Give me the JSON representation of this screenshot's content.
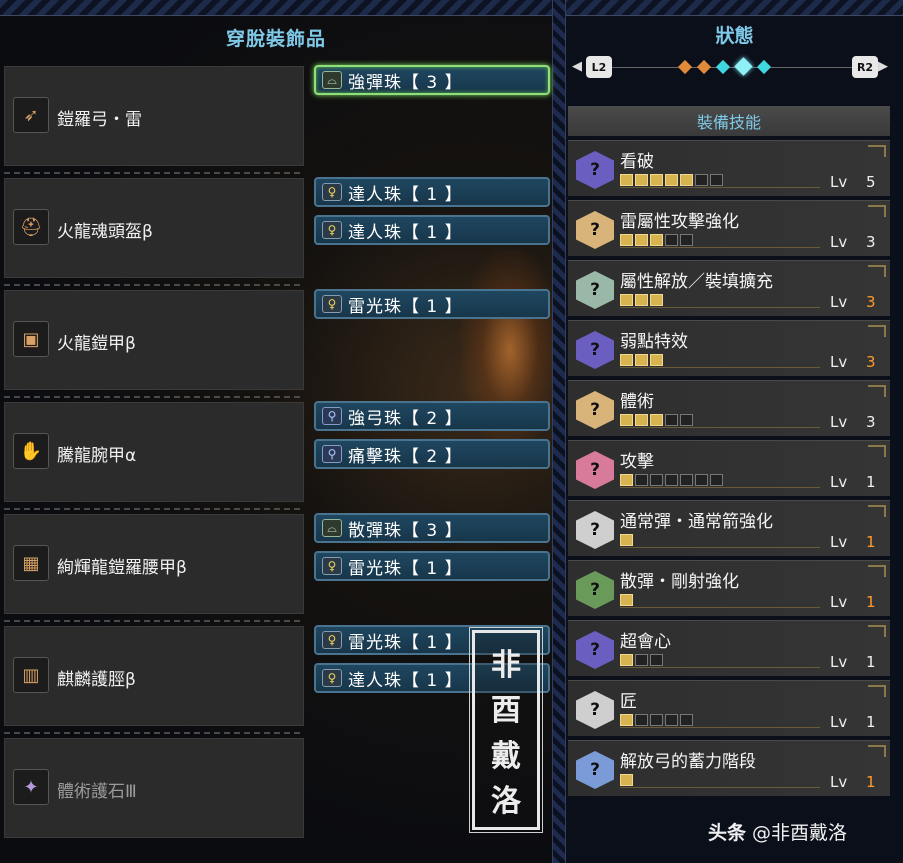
{
  "left_header": "穿脫裝飾品",
  "right_header": "狀態",
  "nav": {
    "left_button": "L2",
    "right_button": "R2"
  },
  "equipment": [
    {
      "name": "鎧羅弓・雷",
      "icon": "bow-icon",
      "slots": [
        {
          "label": "強彈珠【 3 】",
          "level": 3,
          "selected": true
        }
      ]
    },
    {
      "name": "火龍魂頭盔β",
      "icon": "helmet-icon",
      "slots": [
        {
          "label": "達人珠【 1 】",
          "level": 1
        },
        {
          "label": "達人珠【 1 】",
          "level": 1
        }
      ]
    },
    {
      "name": "火龍鎧甲β",
      "icon": "chest-armor-icon",
      "slots": [
        {
          "label": "雷光珠【 1 】",
          "level": 1
        }
      ]
    },
    {
      "name": "騰龍腕甲α",
      "icon": "gauntlet-icon",
      "slots": [
        {
          "label": "強弓珠【 2 】",
          "level": 2
        },
        {
          "label": "痛擊珠【 2 】",
          "level": 2
        }
      ]
    },
    {
      "name": "絢輝龍鎧羅腰甲β",
      "icon": "waist-armor-icon",
      "slots": [
        {
          "label": "散彈珠【 3 】",
          "level": 3
        },
        {
          "label": "雷光珠【 1 】",
          "level": 1
        }
      ]
    },
    {
      "name": "麒麟護脛β",
      "icon": "leg-armor-icon",
      "slots": [
        {
          "label": "雷光珠【 1 】",
          "level": 1
        },
        {
          "label": "達人珠【 1 】",
          "level": 1
        }
      ]
    },
    {
      "name": "體術護石Ⅲ",
      "icon": "charm-icon",
      "dim": true,
      "slots": []
    }
  ],
  "skills_title": "裝備技能",
  "lv_label": "Lv",
  "skills": [
    {
      "name": "看破",
      "level": "5",
      "filled": 5,
      "max": 7,
      "color": "#6a5fc0",
      "is_max": false
    },
    {
      "name": "雷屬性攻擊強化",
      "level": "3",
      "filled": 3,
      "max": 5,
      "color": "#d8b47a",
      "is_max": false
    },
    {
      "name": "屬性解放／裝填擴充",
      "level": "3",
      "filled": 3,
      "max": 3,
      "color": "#9ab8a8",
      "is_max": true
    },
    {
      "name": "弱點特效",
      "level": "3",
      "filled": 3,
      "max": 3,
      "color": "#6a5fc0",
      "is_max": true
    },
    {
      "name": "體術",
      "level": "3",
      "filled": 3,
      "max": 5,
      "color": "#d8b47a",
      "is_max": false
    },
    {
      "name": "攻擊",
      "level": "1",
      "filled": 1,
      "max": 7,
      "color": "#d87a9a",
      "is_max": false
    },
    {
      "name": "通常彈・通常箭強化",
      "level": "1",
      "filled": 1,
      "max": 1,
      "color": "#cfcfcf",
      "is_max": true
    },
    {
      "name": "散彈・剛射強化",
      "level": "1",
      "filled": 1,
      "max": 1,
      "color": "#6a9a5a",
      "is_max": true
    },
    {
      "name": "超會心",
      "level": "1",
      "filled": 1,
      "max": 3,
      "color": "#6a5fc0",
      "is_max": false
    },
    {
      "name": "匠",
      "level": "1",
      "filled": 1,
      "max": 5,
      "color": "#cfcfcf",
      "is_max": false
    },
    {
      "name": "解放弓的蓄力階段",
      "level": "1",
      "filled": 1,
      "max": 1,
      "color": "#7a9ad8",
      "is_max": true
    }
  ],
  "watermark": {
    "seal_chars": [
      "非",
      "酉",
      "戴",
      "洛"
    ],
    "footer_brand": "头条",
    "footer_handle": " @非酉戴洛"
  }
}
